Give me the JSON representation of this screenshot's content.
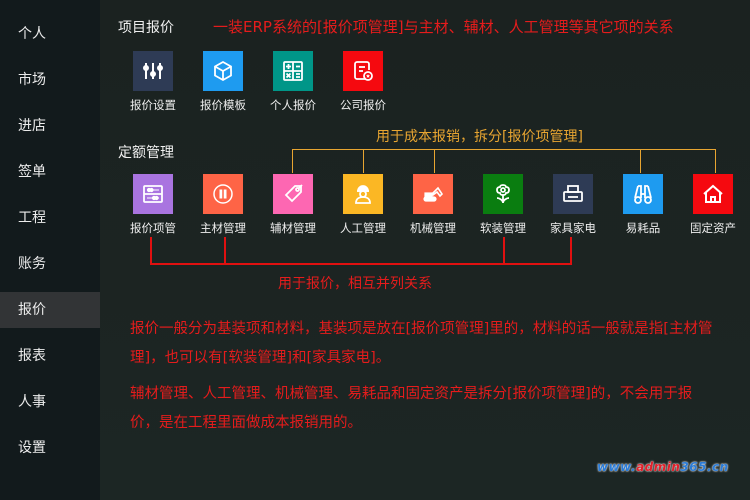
{
  "sidebar": {
    "items": [
      {
        "label": "个人",
        "active": false
      },
      {
        "label": "市场",
        "active": false
      },
      {
        "label": "进店",
        "active": false
      },
      {
        "label": "签单",
        "active": false
      },
      {
        "label": "工程",
        "active": false
      },
      {
        "label": "账务",
        "active": false
      },
      {
        "label": "报价",
        "active": true
      },
      {
        "label": "报表",
        "active": false
      },
      {
        "label": "人事",
        "active": false
      },
      {
        "label": "设置",
        "active": false
      }
    ]
  },
  "project_quote": {
    "title": "项目报价",
    "annotation": "一装ERP系统的[报价项管理]与主材、辅材、人工管理等其它项的关系",
    "tiles": [
      {
        "label": "报价设置",
        "icon": "sliders-icon",
        "color": "#2e3b55"
      },
      {
        "label": "报价模板",
        "icon": "cube-icon",
        "color": "#1e9bf0"
      },
      {
        "label": "个人报价",
        "icon": "calculator-icon",
        "color": "#009688"
      },
      {
        "label": "公司报价",
        "icon": "document-badge-icon",
        "color": "#f5090f"
      }
    ]
  },
  "quota_management": {
    "title": "定额管理",
    "cost_annotation": "用于成本报销，拆分[报价项管理]",
    "quote_annotation": "用于报价，相互并列关系",
    "tiles": [
      {
        "label": "报价项管",
        "icon": "abacus-icon",
        "color": "#a974e0"
      },
      {
        "label": "主材管理",
        "icon": "door-circle-icon",
        "color": "#fe6446"
      },
      {
        "label": "辅材管理",
        "icon": "tag-icon",
        "color": "#fd67b2"
      },
      {
        "label": "人工管理",
        "icon": "worker-icon",
        "color": "#fbb724"
      },
      {
        "label": "机械管理",
        "icon": "excavator-icon",
        "color": "#fe6446"
      },
      {
        "label": "软装管理",
        "icon": "flower-icon",
        "color": "#0a7d10"
      },
      {
        "label": "家具家电",
        "icon": "printer-icon",
        "color": "#2e3b55"
      },
      {
        "label": "易耗品",
        "icon": "binoculars-icon",
        "color": "#1e9bf0"
      },
      {
        "label": "固定资产",
        "icon": "house-icon",
        "color": "#f5090f"
      }
    ]
  },
  "explanation": {
    "paragraph1": "报价一般分为基装项和材料，基装项是放在[报价项管理]里的，材料的话一般就是指[主材管理]，也可以有[软装管理]和[家具家电]。",
    "paragraph2": "辅材管理、人工管理、机械管理、易耗品和固定资产是拆分[报价项管理]的，不会用于报价，是在工程里面做成本报销用的。"
  },
  "watermark": {
    "part1": "www.",
    "part2": "admin",
    "part3": "365.cn"
  },
  "colors": {
    "annotation_red": "#e51c1c",
    "annotation_gold": "#e8a531",
    "sidebar_active": "#323436"
  }
}
